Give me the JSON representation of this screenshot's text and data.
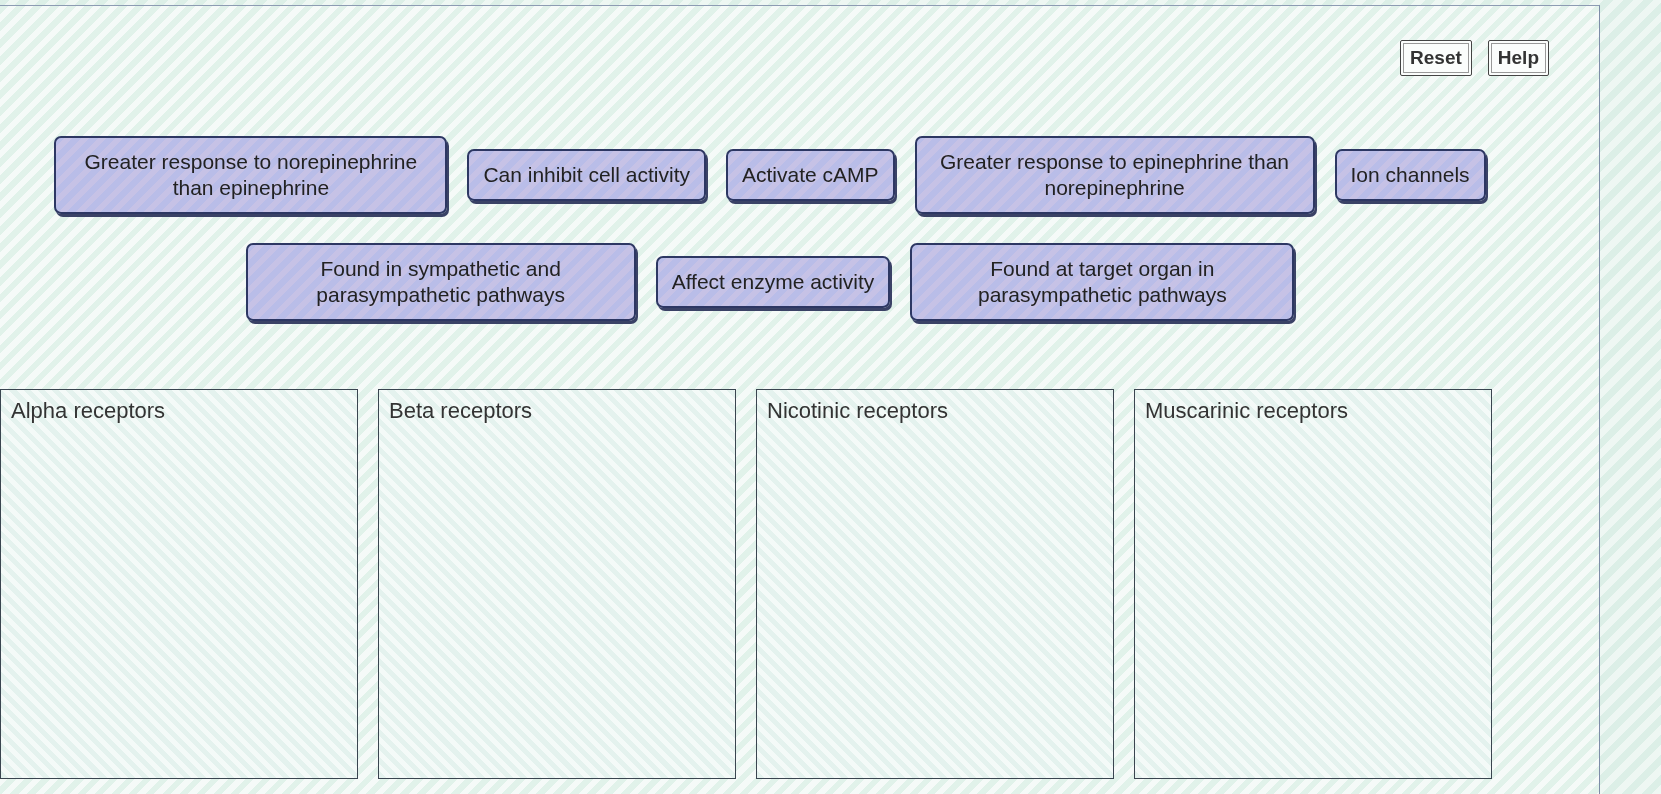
{
  "toolbar": {
    "buttons": [
      "Reset",
      "Help"
    ]
  },
  "tile_rows": [
    [
      "Greater response to norepinephrine than epinephrine",
      "Can inhibit cell activity",
      "Activate cAMP",
      "Greater response to epinephrine than norepinephrine",
      "Ion channels"
    ],
    [
      "Found in sympathetic and parasympathetic pathways",
      "Affect enzyme activity",
      "Found at target organ in parasympathetic pathways"
    ]
  ],
  "drop_zones": [
    {
      "label": "Alpha receptors"
    },
    {
      "label": "Beta receptors"
    },
    {
      "label": "Nicotinic receptors"
    },
    {
      "label": "Muscarinic receptors"
    }
  ]
}
